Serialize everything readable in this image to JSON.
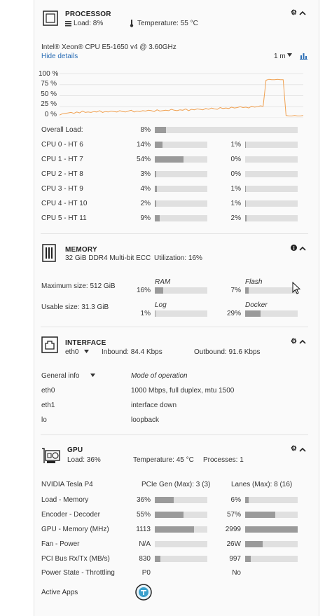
{
  "processor": {
    "title": "PROCESSOR",
    "load": "Load: 8%",
    "temperature": "Temperature: 55 °C",
    "model": "Intel® Xeon® CPU E5-1650 v4 @ 3.60GHz",
    "hide_details": "Hide details",
    "range": "1 m",
    "y_ticks": [
      "100 %",
      "75 %",
      "50 %",
      "25 %",
      "0 %"
    ],
    "overall": {
      "label": "Overall Load:",
      "pct": "8%",
      "value": 0.08
    },
    "cores": [
      {
        "label": "CPU 0 - HT 6",
        "a_pct": "14%",
        "a": 0.14,
        "b_pct": "1%",
        "b": 0.01
      },
      {
        "label": "CPU 1 - HT 7",
        "a_pct": "54%",
        "a": 0.54,
        "b_pct": "0%",
        "b": 0.0
      },
      {
        "label": "CPU 2 - HT 8",
        "a_pct": "3%",
        "a": 0.03,
        "b_pct": "0%",
        "b": 0.0
      },
      {
        "label": "CPU 3 - HT 9",
        "a_pct": "4%",
        "a": 0.04,
        "b_pct": "1%",
        "b": 0.01
      },
      {
        "label": "CPU 4 - HT 10",
        "a_pct": "2%",
        "a": 0.02,
        "b_pct": "1%",
        "b": 0.01
      },
      {
        "label": "CPU 5 - HT 11",
        "a_pct": "9%",
        "a": 0.09,
        "b_pct": "2%",
        "b": 0.02
      }
    ]
  },
  "chart_data": {
    "type": "line",
    "title": "",
    "ylim": [
      0,
      100
    ],
    "y_ticks": [
      "100 %",
      "75 %",
      "50 %",
      "25 %",
      "0 %"
    ],
    "color": "#f0a050",
    "series": [
      {
        "values": [
          6,
          9,
          10,
          11,
          12,
          10,
          13,
          11,
          15,
          12,
          13,
          12,
          14,
          13,
          16,
          12,
          14,
          13,
          15,
          14,
          13,
          16,
          14,
          13,
          15,
          17,
          13,
          15,
          14,
          16,
          15,
          17,
          16,
          14,
          18,
          15,
          16,
          17,
          16,
          19,
          17,
          16,
          18,
          17,
          20,
          16,
          19,
          18,
          20,
          19,
          18,
          21,
          19,
          22,
          20,
          19,
          23,
          21,
          22,
          21,
          24,
          22,
          23,
          25,
          23,
          24,
          22,
          26,
          24,
          25,
          27,
          26,
          85,
          87,
          86,
          86,
          87,
          86,
          86,
          5,
          4,
          4,
          5,
          4,
          4,
          5
        ]
      }
    ]
  },
  "memory": {
    "title": "MEMORY",
    "spec": "32 GiB DDR4 Multi-bit ECC",
    "utilization": "Utilization: 16%",
    "max_size": "Maximum size: 512 GiB",
    "usable_size": "Usable size: 31.3 GiB",
    "ram": {
      "label": "RAM",
      "pct": "16%",
      "value": 0.16
    },
    "flash": {
      "label": "Flash",
      "pct": "7%",
      "value": 0.07
    },
    "log": {
      "label": "Log",
      "pct": "1%",
      "value": 0.01
    },
    "docker": {
      "label": "Docker",
      "pct": "29%",
      "value": 0.29
    }
  },
  "interface": {
    "title": "INTERFACE",
    "selected": "eth0",
    "inbound": "Inbound: 84.4 Kbps",
    "outbound": "Outbound: 91.6 Kbps",
    "col1": "General info",
    "col2": "Mode of operation",
    "rows": [
      {
        "name": "eth0",
        "mode": "1000 Mbps, full duplex, mtu 1500"
      },
      {
        "name": "eth1",
        "mode": "interface down"
      },
      {
        "name": "lo",
        "mode": "loopback"
      }
    ]
  },
  "gpu": {
    "title": "GPU",
    "load": "Load: 36%",
    "temperature": "Temperature: 45 °C",
    "processes": "Processes: 1",
    "name": "NVIDIA Tesla P4",
    "pcie": "PCIe Gen (Max): 3 (3)",
    "lanes": "Lanes (Max): 8 (16)",
    "rows": [
      {
        "label": "Load - Memory",
        "a_txt": "36%",
        "a": 0.36,
        "b_txt": "6%",
        "b": 0.06
      },
      {
        "label": "Encoder - Decoder",
        "a_txt": "55%",
        "a": 0.55,
        "b_txt": "57%",
        "b": 0.57
      },
      {
        "label": "GPU - Memory (MHz)",
        "a_txt": "1113",
        "a": 0.74,
        "b_txt": "2999",
        "b": 1.0
      },
      {
        "label": "Fan - Power",
        "a_txt": "N/A",
        "a": 0.0,
        "b_txt": "26W",
        "b": 0.33
      },
      {
        "label": "PCI Bus Rx/Tx (MB/s)",
        "a_txt": "830",
        "a": 0.1,
        "b_txt": "997",
        "b": 0.1
      }
    ],
    "power_label": "Power State - Throttling",
    "power_a": "P0",
    "power_b": "No",
    "active_apps": "Active Apps"
  }
}
